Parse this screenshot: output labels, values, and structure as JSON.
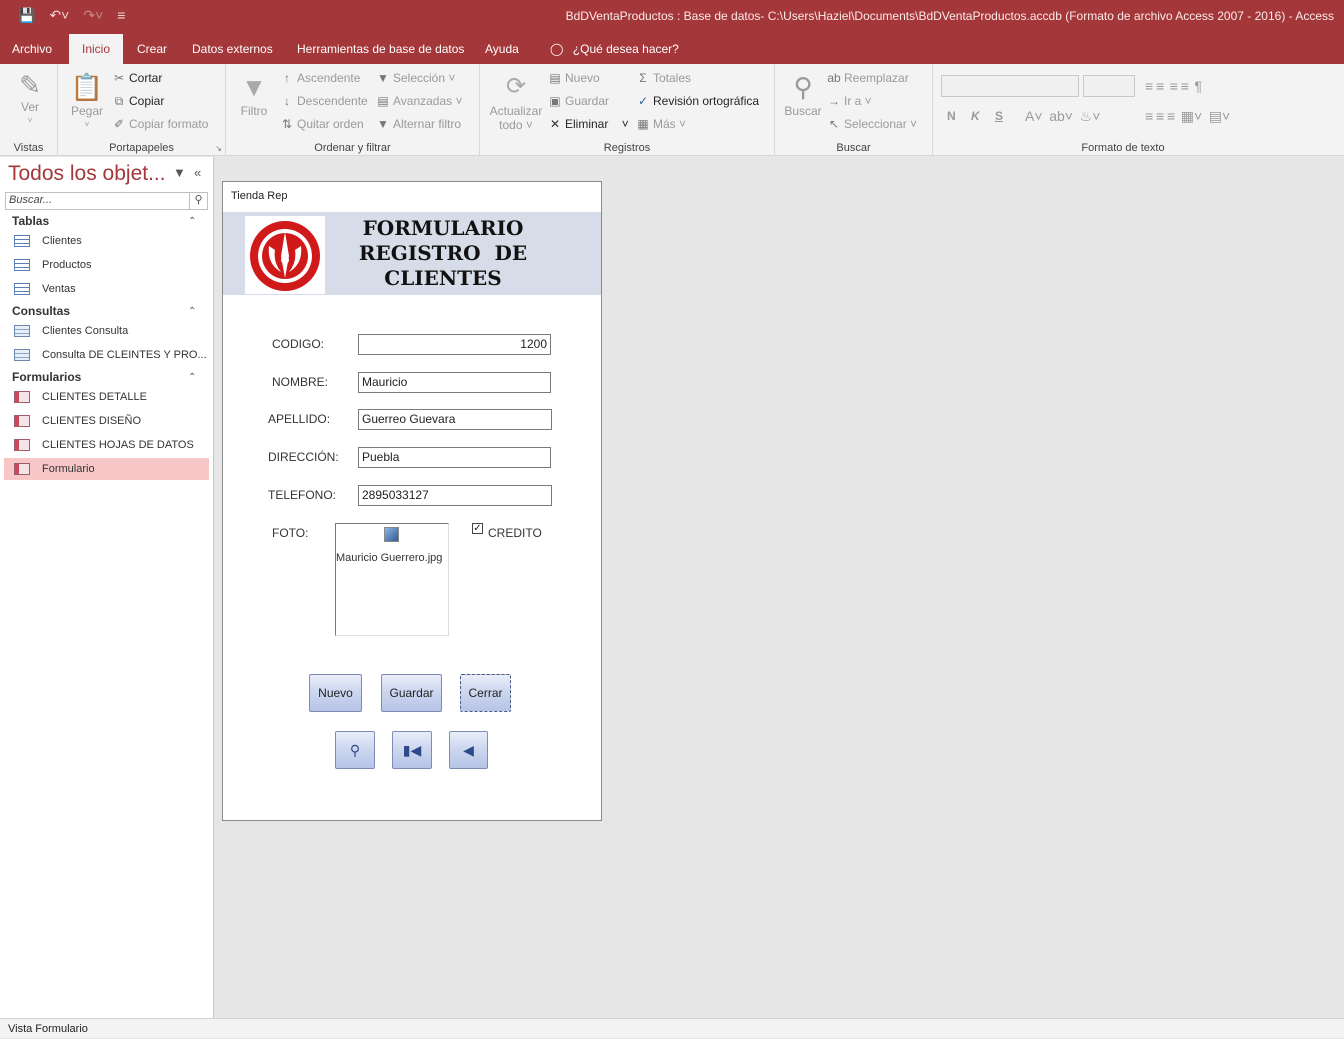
{
  "window": {
    "title": "BdDVentaProductos : Base de datos- C:\\Users\\Haziel\\Documents\\BdDVentaProductos.accdb (Formato de archivo Access 2007 - 2016)  -  Access"
  },
  "tabs": [
    "Archivo",
    "Inicio",
    "Crear",
    "Datos externos",
    "Herramientas de base de datos",
    "Ayuda"
  ],
  "tell_me": "¿Qué desea hacer?",
  "ribbon": {
    "vistas": {
      "label": "Vistas",
      "ver": "Ver"
    },
    "portapapeles": {
      "label": "Portapapeles",
      "pegar": "Pegar",
      "cortar": "Cortar",
      "copiar": "Copiar",
      "copiar_formato": "Copiar formato"
    },
    "ordenar": {
      "label": "Ordenar y filtrar",
      "filtro": "Filtro",
      "ascendente": "Ascendente",
      "descendente": "Descendente",
      "quitar_orden": "Quitar orden",
      "seleccion": "Selección",
      "avanzadas": "Avanzadas",
      "alternar_filtro": "Alternar filtro"
    },
    "registros": {
      "label": "Registros",
      "actualizar": "Actualizar",
      "todo": "todo",
      "nuevo": "Nuevo",
      "guardar": "Guardar",
      "eliminar": "Eliminar",
      "totales": "Totales",
      "revision": "Revisión ortográfica",
      "mas": "Más"
    },
    "buscar": {
      "label": "Buscar",
      "buscar": "Buscar",
      "reemplazar": "Reemplazar",
      "ir_a": "Ir a",
      "seleccionar": "Seleccionar"
    },
    "formato": {
      "label": "Formato de texto",
      "bold": "N",
      "italic": "K",
      "underline": "S"
    }
  },
  "nav": {
    "title": "Todos los objet...",
    "search_placeholder": "Buscar...",
    "sections": [
      {
        "label": "Tablas",
        "items": [
          "Clientes",
          "Productos",
          "Ventas"
        ]
      },
      {
        "label": "Consultas",
        "items": [
          "Clientes Consulta",
          "Consulta DE CLEINTES Y PRO..."
        ]
      },
      {
        "label": "Formularios",
        "items": [
          "CLIENTES DETALLE",
          "CLIENTES DISEÑO",
          "CLIENTES HOJAS DE DATOS",
          "Formulario"
        ]
      }
    ],
    "selected_item": "Formulario"
  },
  "form": {
    "title": "Tienda Rep",
    "header": [
      "FORMULARIO",
      "REGISTRO  DE",
      "CLIENTES"
    ],
    "fields": {
      "codigo": {
        "label": "CODIGO:",
        "value": "1200"
      },
      "nombre": {
        "label": "NOMBRE:",
        "value": "Mauricio"
      },
      "apellido": {
        "label": "APELLIDO:",
        "value": "Guerreo Guevara"
      },
      "direccion": {
        "label": "DIRECCIÓN:",
        "value": "Puebla"
      },
      "telefono": {
        "label": "TELEFONO:",
        "value": "2895033127"
      }
    },
    "foto": {
      "label": "FOTO:",
      "filename": "Mauricio Guerrero.jpg"
    },
    "credito": {
      "label": "CREDITO",
      "checked": true
    },
    "buttons": {
      "nuevo": "Nuevo",
      "guardar": "Guardar",
      "cerrar": "Cerrar"
    },
    "nav_buttons": [
      "search-icon",
      "first-record-icon",
      "previous-record-icon"
    ]
  },
  "status": "Vista Formulario",
  "colors": {
    "accent": "#a4373a",
    "selected": "#f7c6c7",
    "header_band": "#d6dde8"
  }
}
